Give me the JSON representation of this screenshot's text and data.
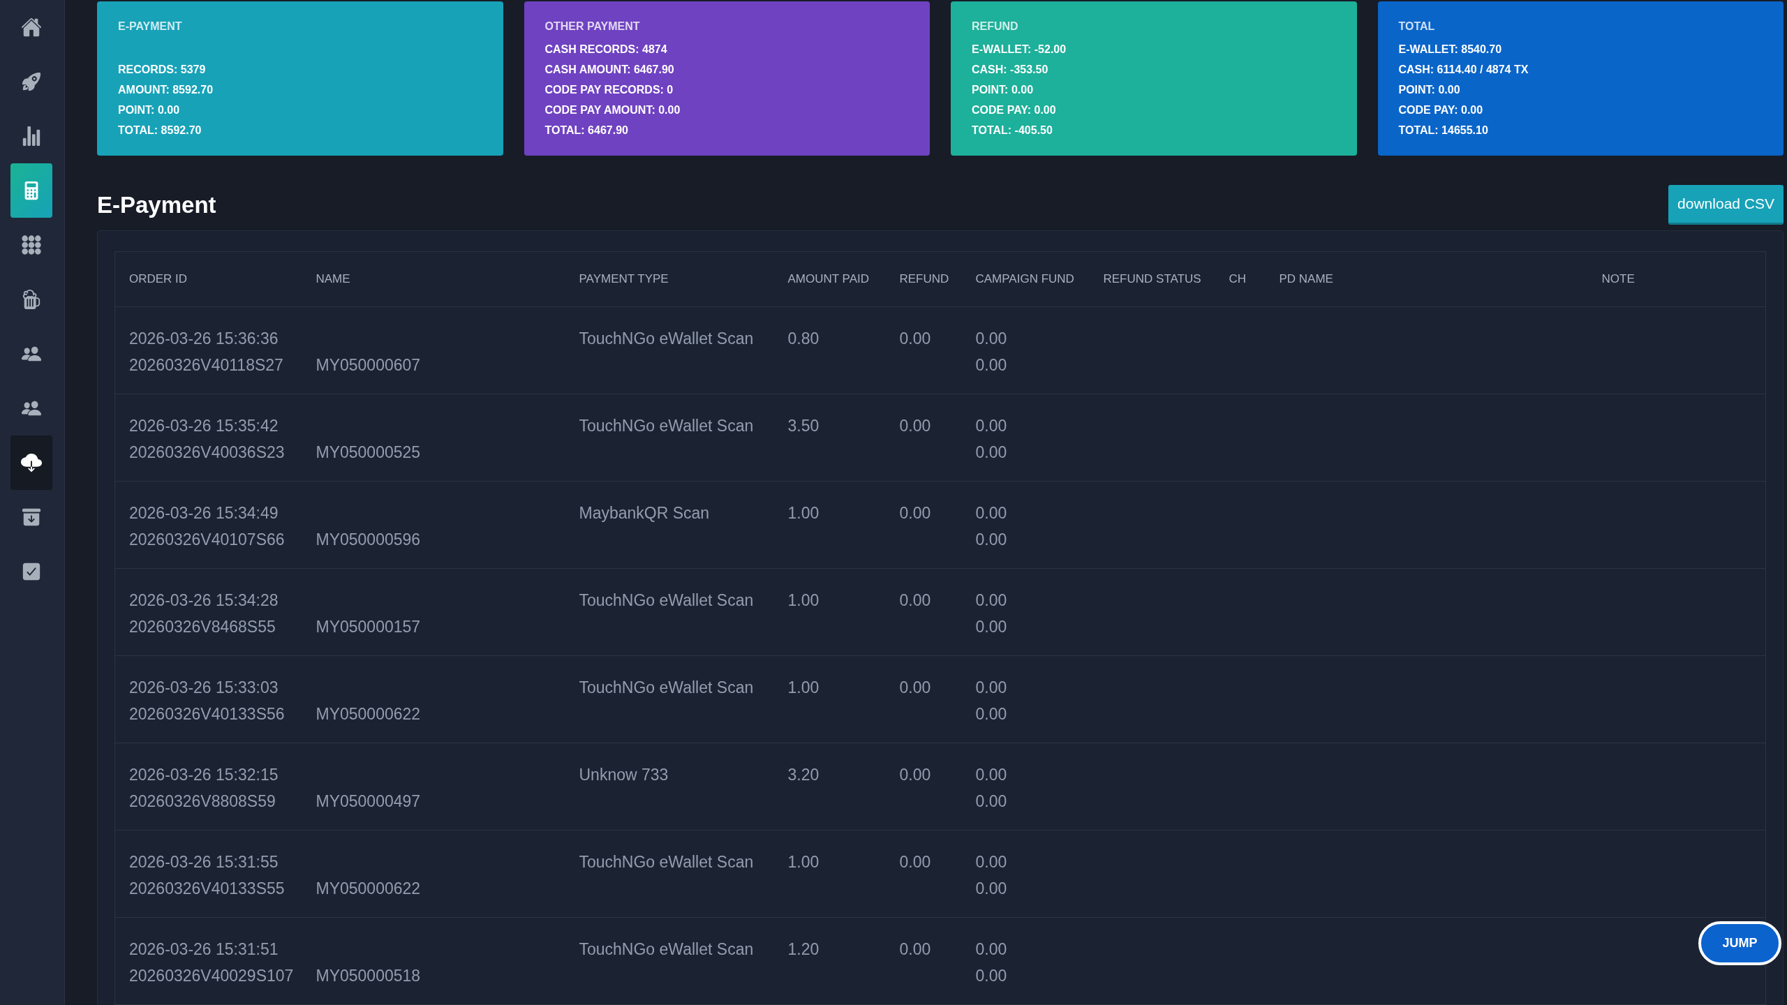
{
  "sidebar": {
    "items": [
      {
        "selected": false,
        "hovered": false
      },
      {
        "selected": false,
        "hovered": false
      },
      {
        "selected": false,
        "hovered": false
      },
      {
        "selected": true,
        "hovered": false
      },
      {
        "selected": false,
        "hovered": false
      },
      {
        "selected": false,
        "hovered": false
      },
      {
        "selected": false,
        "hovered": false
      },
      {
        "selected": false,
        "hovered": false
      },
      {
        "selected": false,
        "hovered": true
      },
      {
        "selected": false,
        "hovered": false
      },
      {
        "selected": false,
        "hovered": false
      }
    ]
  },
  "cards": [
    {
      "title": "E-PAYMENT",
      "color": "#17a2b8",
      "lines": [
        "RECORDS: 5379",
        "AMOUNT: 8592.70",
        "POINT: 0.00",
        "TOTAL: 8592.70"
      ]
    },
    {
      "title": "OTHER PAYMENT",
      "color": "#6f42c1",
      "lines": [
        "CASH RECORDS: 4874",
        "CASH AMOUNT: 6467.90",
        "CODE PAY RECORDS: 0",
        "CODE PAY AMOUNT: 0.00",
        "TOTAL: 6467.90"
      ]
    },
    {
      "title": "REFUND",
      "color": "#1db09a",
      "lines": [
        "E-WALLET: -52.00",
        "CASH: -353.50",
        "POINT: 0.00",
        "CODE PAY: 0.00",
        "TOTAL: -405.50"
      ]
    },
    {
      "title": "TOTAL",
      "color": "#0a65c9",
      "lines": [
        "E-WALLET: 8540.70",
        "CASH: 6114.40 / 4874 TX",
        "POINT: 0.00",
        "CODE PAY: 0.00",
        "TOTAL: 14655.10"
      ]
    }
  ],
  "section": {
    "title": "E-Payment",
    "button": "download CSV"
  },
  "table": {
    "columns": [
      "ORDER ID",
      "NAME",
      "PAYMENT TYPE",
      "AMOUNT PAID",
      "REFUND",
      "CAMPAIGN FUND",
      "REFUND STATUS",
      "CH",
      "PD NAME",
      "NOTE"
    ],
    "rows": [
      {
        "datetime": "2026-03-26 15:36:36",
        "order_id": "20260326V40118S27",
        "name": "MY050000607",
        "payment_type": "TouchNGo eWallet Scan",
        "amount_paid": "0.80",
        "refund": "0.00",
        "campaign_fund": [
          "0.00",
          "0.00"
        ]
      },
      {
        "datetime": "2026-03-26 15:35:42",
        "order_id": "20260326V40036S23",
        "name": "MY050000525",
        "payment_type": "TouchNGo eWallet Scan",
        "amount_paid": "3.50",
        "refund": "0.00",
        "campaign_fund": [
          "0.00",
          "0.00"
        ]
      },
      {
        "datetime": "2026-03-26 15:34:49",
        "order_id": "20260326V40107S66",
        "name": "MY050000596",
        "payment_type": "MaybankQR Scan",
        "amount_paid": "1.00",
        "refund": "0.00",
        "campaign_fund": [
          "0.00",
          "0.00"
        ]
      },
      {
        "datetime": "2026-03-26 15:34:28",
        "order_id": "20260326V8468S55",
        "name": "MY050000157",
        "payment_type": "TouchNGo eWallet Scan",
        "amount_paid": "1.00",
        "refund": "0.00",
        "campaign_fund": [
          "0.00",
          "0.00"
        ]
      },
      {
        "datetime": "2026-03-26 15:33:03",
        "order_id": "20260326V40133S56",
        "name": "MY050000622",
        "payment_type": "TouchNGo eWallet Scan",
        "amount_paid": "1.00",
        "refund": "0.00",
        "campaign_fund": [
          "0.00",
          "0.00"
        ]
      },
      {
        "datetime": "2026-03-26 15:32:15",
        "order_id": "20260326V8808S59",
        "name": "MY050000497",
        "payment_type": "Unknow 733",
        "amount_paid": "3.20",
        "refund": "0.00",
        "campaign_fund": [
          "0.00",
          "0.00"
        ]
      },
      {
        "datetime": "2026-03-26 15:31:55",
        "order_id": "20260326V40133S55",
        "name": "MY050000622",
        "payment_type": "TouchNGo eWallet Scan",
        "amount_paid": "1.00",
        "refund": "0.00",
        "campaign_fund": [
          "0.00",
          "0.00"
        ]
      },
      {
        "datetime": "2026-03-26 15:31:51",
        "order_id": "20260326V40029S107",
        "name": "MY050000518",
        "payment_type": "TouchNGo eWallet Scan",
        "amount_paid": "1.20",
        "refund": "0.00",
        "campaign_fund": [
          "0.00",
          "0.00"
        ]
      }
    ]
  },
  "jump_button": "JUMP"
}
